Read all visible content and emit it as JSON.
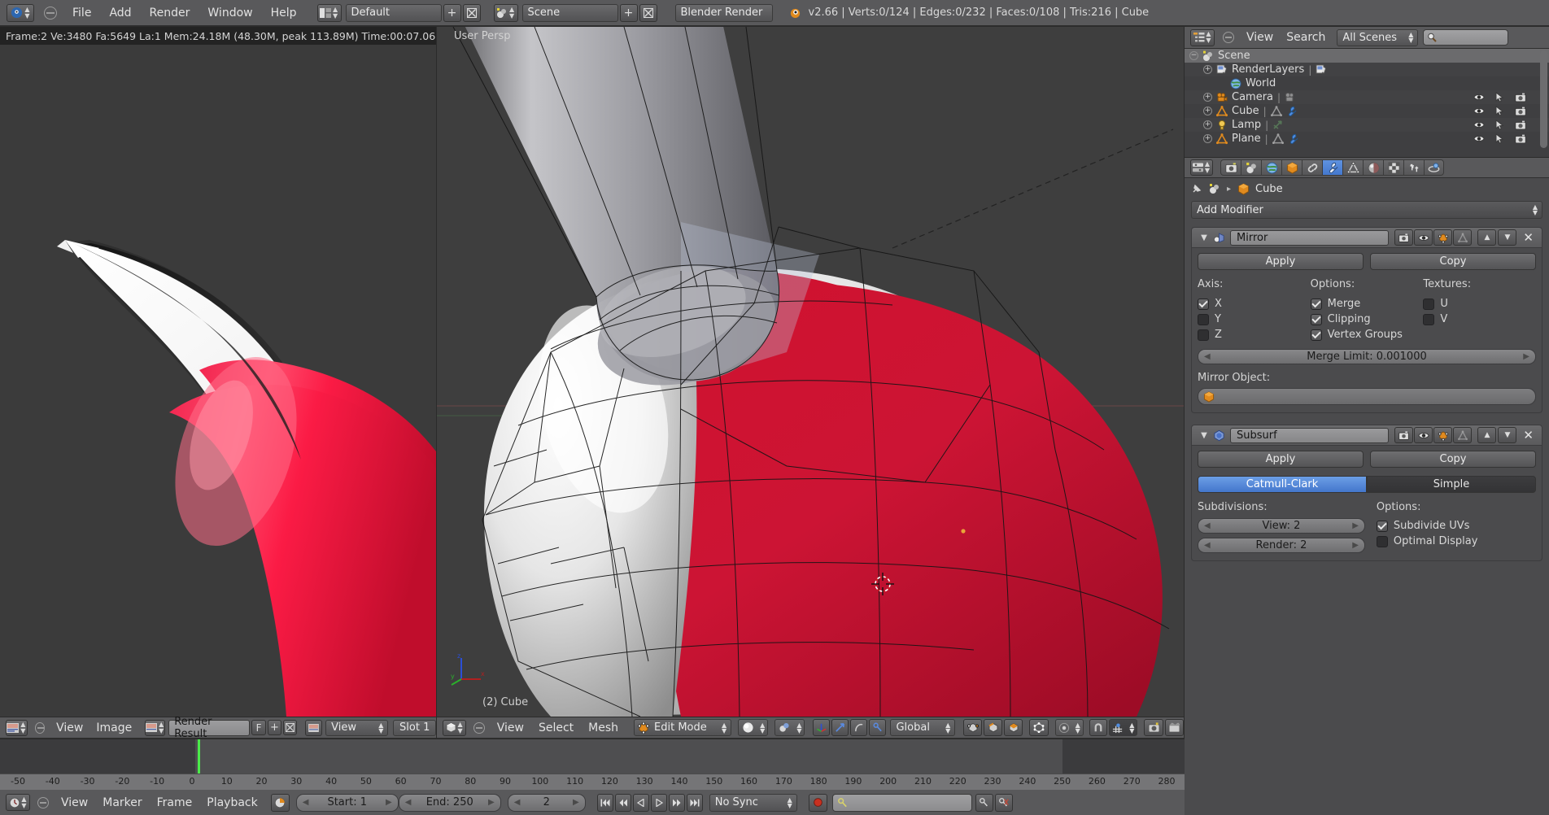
{
  "topbar": {
    "menus": [
      "File",
      "Add",
      "Render",
      "Window",
      "Help"
    ],
    "screen_layout": "Default",
    "scene_name": "Scene",
    "render_engine": "Blender Render",
    "version_info": "v2.66 | Verts:0/124 | Edges:0/232 | Faces:0/108 | Tris:216 | Cube",
    "blender_icon": "blender-logo-icon",
    "collapse_icon": "collapse-menu-icon",
    "layout_icon": "screen-layout-icon",
    "scene_icon": "scene-icon",
    "new_icon": "+",
    "delete_icon": "x"
  },
  "render_stats": "Frame:2 Ve:3480 Fa:5649 La:1 Mem:24.18M (48.30M, peak 113.89M) Time:00:07.06",
  "viewport": {
    "view_label": "User Persp",
    "object_label": "(2) Cube",
    "axis_x": "x",
    "axis_y": "y",
    "axis_z": "z"
  },
  "outliner": {
    "header": {
      "editor_icon": "outliner-editor-icon",
      "collapse_icon": "collapse-menu-icon",
      "menus": [
        "View",
        "Search"
      ],
      "display_mode": "All Scenes",
      "search_placeholder": "",
      "search_icon": "search-icon"
    },
    "rows": [
      {
        "label": "Scene",
        "indent": 0,
        "expander": "minus",
        "icon": "scene-icon",
        "selected": true,
        "restrict": false
      },
      {
        "label": "RenderLayers",
        "indent": 1,
        "expander": "plus",
        "icon": "renderlayers-icon",
        "selected": false,
        "restrict": false,
        "extra_icon": "renderlayer-data-icon"
      },
      {
        "label": "World",
        "indent": 2,
        "expander": "none",
        "icon": "world-icon",
        "selected": false,
        "restrict": false
      },
      {
        "label": "Camera",
        "indent": 1,
        "expander": "plus",
        "icon": "camera-icon",
        "selected": false,
        "restrict": true,
        "extra_icon": "camera-data-icon"
      },
      {
        "label": "Cube",
        "indent": 1,
        "expander": "plus",
        "icon": "mesh-object-icon",
        "selected": false,
        "restrict": true,
        "extra_icon": "mesh-data-icon",
        "extra_icon2": "wrench-modifier-icon"
      },
      {
        "label": "Lamp",
        "indent": 1,
        "expander": "plus",
        "icon": "lamp-icon",
        "selected": false,
        "restrict": true,
        "extra_icon": "animation-data-icon"
      },
      {
        "label": "Plane",
        "indent": 1,
        "expander": "plus",
        "icon": "mesh-object-icon",
        "selected": false,
        "restrict": true,
        "extra_icon": "mesh-data-icon",
        "extra_icon2": "wrench-modifier-icon"
      }
    ],
    "restrict_icons": [
      "eye-icon",
      "cursor-arrow-icon",
      "camera-render-icon"
    ]
  },
  "properties": {
    "editor_icon": "properties-editor-icon",
    "tabs": [
      {
        "name": "render-tab",
        "icon": "camera-back-icon",
        "active": false
      },
      {
        "name": "scene-tab",
        "icon": "scene-icon",
        "active": false
      },
      {
        "name": "world-tab",
        "icon": "world-icon",
        "active": false
      },
      {
        "name": "object-tab",
        "icon": "cube-icon",
        "active": false
      },
      {
        "name": "constraints-tab",
        "icon": "chain-link-icon",
        "active": false
      },
      {
        "name": "modifiers-tab",
        "icon": "wrench-icon",
        "active": true
      },
      {
        "name": "data-tab",
        "icon": "triangle-mesh-icon",
        "active": false
      },
      {
        "name": "material-tab",
        "icon": "sphere-material-icon",
        "active": false
      },
      {
        "name": "texture-tab",
        "icon": "checker-texture-icon",
        "active": false
      },
      {
        "name": "particles-tab",
        "icon": "particles-icon",
        "active": false
      },
      {
        "name": "physics-tab",
        "icon": "physics-orbit-icon",
        "active": false
      }
    ],
    "breadcrumb": {
      "pin_icon": "pin-icon",
      "scene_icon": "scene-icon",
      "separator": "▸",
      "object_icon": "cube-icon",
      "object_name": "Cube"
    },
    "add_modifier": "Add Modifier",
    "modifiers": [
      {
        "name": "Mirror",
        "type_icon": "mirror-modifier-icon",
        "collapse_icon": "chevron-down-icon",
        "header_toggles": [
          "render-toggle-icon",
          "realtime-eye-icon",
          "editmode-toggle-icon",
          "oncage-toggle-icon"
        ],
        "move_up_icon": "chevron-up-icon",
        "move_down_icon": "chevron-down-icon",
        "close_icon": "x-close-icon",
        "apply_label": "Apply",
        "copy_label": "Copy",
        "columns": [
          {
            "title": "Axis:",
            "items": [
              {
                "label": "X",
                "checked": true
              },
              {
                "label": "Y",
                "checked": false
              },
              {
                "label": "Z",
                "checked": false
              }
            ]
          },
          {
            "title": "Options:",
            "items": [
              {
                "label": "Merge",
                "checked": true
              },
              {
                "label": "Clipping",
                "checked": true
              },
              {
                "label": "Vertex Groups",
                "checked": true
              }
            ]
          },
          {
            "title": "Textures:",
            "items": [
              {
                "label": "U",
                "checked": false
              },
              {
                "label": "V",
                "checked": false
              }
            ]
          }
        ],
        "merge_limit": "Merge Limit: 0.001000",
        "mirror_object_label": "Mirror Object:",
        "mirror_object_value": "",
        "mirror_object_icon": "cube-icon"
      },
      {
        "name": "Subsurf",
        "type_icon": "subsurf-modifier-icon",
        "collapse_icon": "chevron-down-icon",
        "header_toggles": [
          "render-toggle-icon",
          "realtime-eye-icon",
          "editmode-toggle-icon",
          "oncage-toggle-icon"
        ],
        "move_up_icon": "chevron-up-icon",
        "move_down_icon": "chevron-down-icon",
        "close_icon": "x-close-icon",
        "apply_label": "Apply",
        "copy_label": "Copy",
        "subdiv_type": {
          "options": [
            "Catmull-Clark",
            "Simple"
          ],
          "selected": "Catmull-Clark"
        },
        "subdivisions_label": "Subdivisions:",
        "view_value": "View: 2",
        "render_value": "Render: 2",
        "options_label": "Options:",
        "options": [
          {
            "label": "Subdivide UVs",
            "checked": true
          },
          {
            "label": "Optimal Display",
            "checked": false
          }
        ]
      }
    ]
  },
  "image_editor": {
    "editor_icon": "image-editor-icon",
    "collapse_icon": "collapse-menu-icon",
    "menus": [
      "View",
      "Image"
    ],
    "image_icon": "image-datablock-icon",
    "image_name": "Render Result",
    "fake_user_label": "F",
    "new_icon": "+",
    "delete_icon": "x",
    "view_icon": "image-datablock-icon",
    "view_mode": "View",
    "slot": "Slot 1"
  },
  "view3d_header": {
    "editor_icon": "view3d-editor-icon",
    "collapse_icon": "collapse-menu-icon",
    "menus": [
      "View",
      "Select",
      "Mesh"
    ],
    "mode_icon": "editmode-icon",
    "mode": "Edit Mode",
    "shading_icon": "solid-shading-icon",
    "pivot_icon": "pivot-median-icon",
    "manipulator_icons": [
      "manipulator-toggle-icon",
      "translate-manipulator-icon",
      "rotate-manipulator-icon",
      "scale-manipulator-icon"
    ],
    "orientation": "Global",
    "select_mode_icons": [
      "vertex-select-icon",
      "edge-select-icon",
      "face-select-icon"
    ],
    "occlude_icon": "occlude-geometry-icon",
    "proportional_icon": "proportional-edit-icon",
    "falloff_icon": "falloff-curve-icon",
    "snap_icon": "snap-magnet-icon",
    "snap_element_icon": "snap-increment-icon",
    "render_icons": [
      "render-opengl-icon",
      "render-opengl-anim-icon"
    ]
  },
  "timeline": {
    "editor_icon": "timeline-editor-icon",
    "collapse_icon": "collapse-menu-icon",
    "menus": [
      "View",
      "Marker",
      "Frame",
      "Playback"
    ],
    "autokey_icon": "auto-keyframe-icon",
    "start_label": "Start: 1",
    "end_label": "End: 250",
    "current_frame": "2",
    "transport_icons": [
      "jump-start-icon",
      "prev-keyframe-icon",
      "play-reverse-icon",
      "play-icon",
      "next-keyframe-icon",
      "jump-end-icon"
    ],
    "sync_mode": "No Sync",
    "record_icon": "record-icon",
    "keying_set_icon": "keyingset-icon",
    "keying_set_value": "",
    "insert_key_icon": "insert-keyframe-icon",
    "delete_key_icon": "delete-keyframe-icon",
    "ruler_ticks": [
      -50,
      -40,
      -30,
      -20,
      -10,
      0,
      10,
      20,
      30,
      40,
      50,
      60,
      70,
      80,
      90,
      100,
      110,
      120,
      130,
      140,
      150,
      160,
      170,
      180,
      190,
      200,
      210,
      220,
      230,
      240,
      250,
      260,
      270,
      280
    ],
    "playhead_frame": 2,
    "range_start": 1,
    "range_end": 250
  },
  "colors": {
    "header_bg": "#59595b",
    "panel_bg": "#4b4b4d",
    "viewport_bg": "#3e3e3e",
    "accent_blue": "#4f7fd4",
    "mesh_red": "#cf1636",
    "orange": "#e08a1e"
  }
}
